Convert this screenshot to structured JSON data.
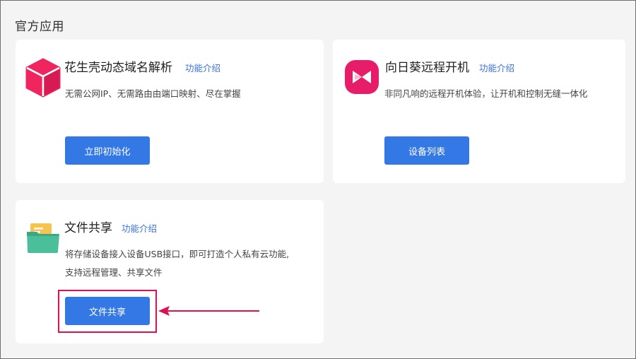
{
  "section": {
    "title": "官方应用"
  },
  "apps": [
    {
      "name": "花生壳动态域名解析",
      "feature_link": "功能介绍",
      "description": "无需公网IP、无需路由由端口映射、尽在掌握",
      "button_label": "立即初始化",
      "icon": "cube-icon",
      "icon_color": "#f0245f"
    },
    {
      "name": "向日葵远程开机",
      "feature_link": "功能介绍",
      "description": "非同凡响的远程开机体验，让开机和控制无缝一体化",
      "button_label": "设备列表",
      "icon": "sunflower-icon",
      "icon_color": "#e81d6a"
    },
    {
      "name": "文件共享",
      "feature_link": "功能介绍",
      "description_line1": "将存储设备接入设备USB接口，即可打造个人私有云功能,",
      "description_line2": "支持远程管理、共享文件",
      "button_label": "文件共享",
      "icon": "folder-icon",
      "icon_color": "#4bbf9a"
    }
  ],
  "colors": {
    "primary_button": "#3478e5",
    "link": "#3a73d6",
    "annotation": "#e0104e",
    "background": "#f4f4f4"
  }
}
